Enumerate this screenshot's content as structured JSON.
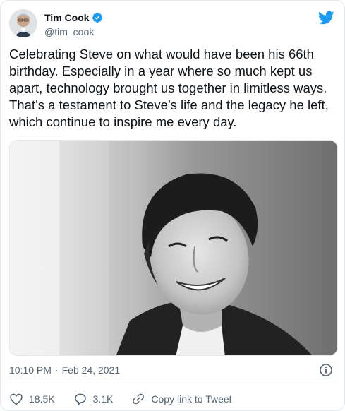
{
  "author": {
    "display_name": "Tim Cook",
    "handle": "@tim_cook",
    "verified_icon": "verified-badge-icon",
    "avatar": "avatar"
  },
  "brand_icon": "twitter-bird-icon",
  "tweet_text": "Celebrating Steve on what would have been his 66th birthday. Especially in a year where so much kept us apart, technology brought us together in limitless ways. That’s a testament to Steve’s life and the legacy he left, which continue to inspire me every day.",
  "media": {
    "kind": "black-and-white portrait photo"
  },
  "meta": {
    "time": "10:10 PM",
    "separator": "·",
    "date": "Feb 24, 2021",
    "info_icon": "info-icon"
  },
  "actions": {
    "likes": "18.5K",
    "replies": "3.1K",
    "copy_link": "Copy link to Tweet"
  },
  "colors": {
    "accent": "#1d9bf0",
    "text": "#0f1419",
    "secondary": "#536471",
    "border": "#e1e8ed"
  }
}
